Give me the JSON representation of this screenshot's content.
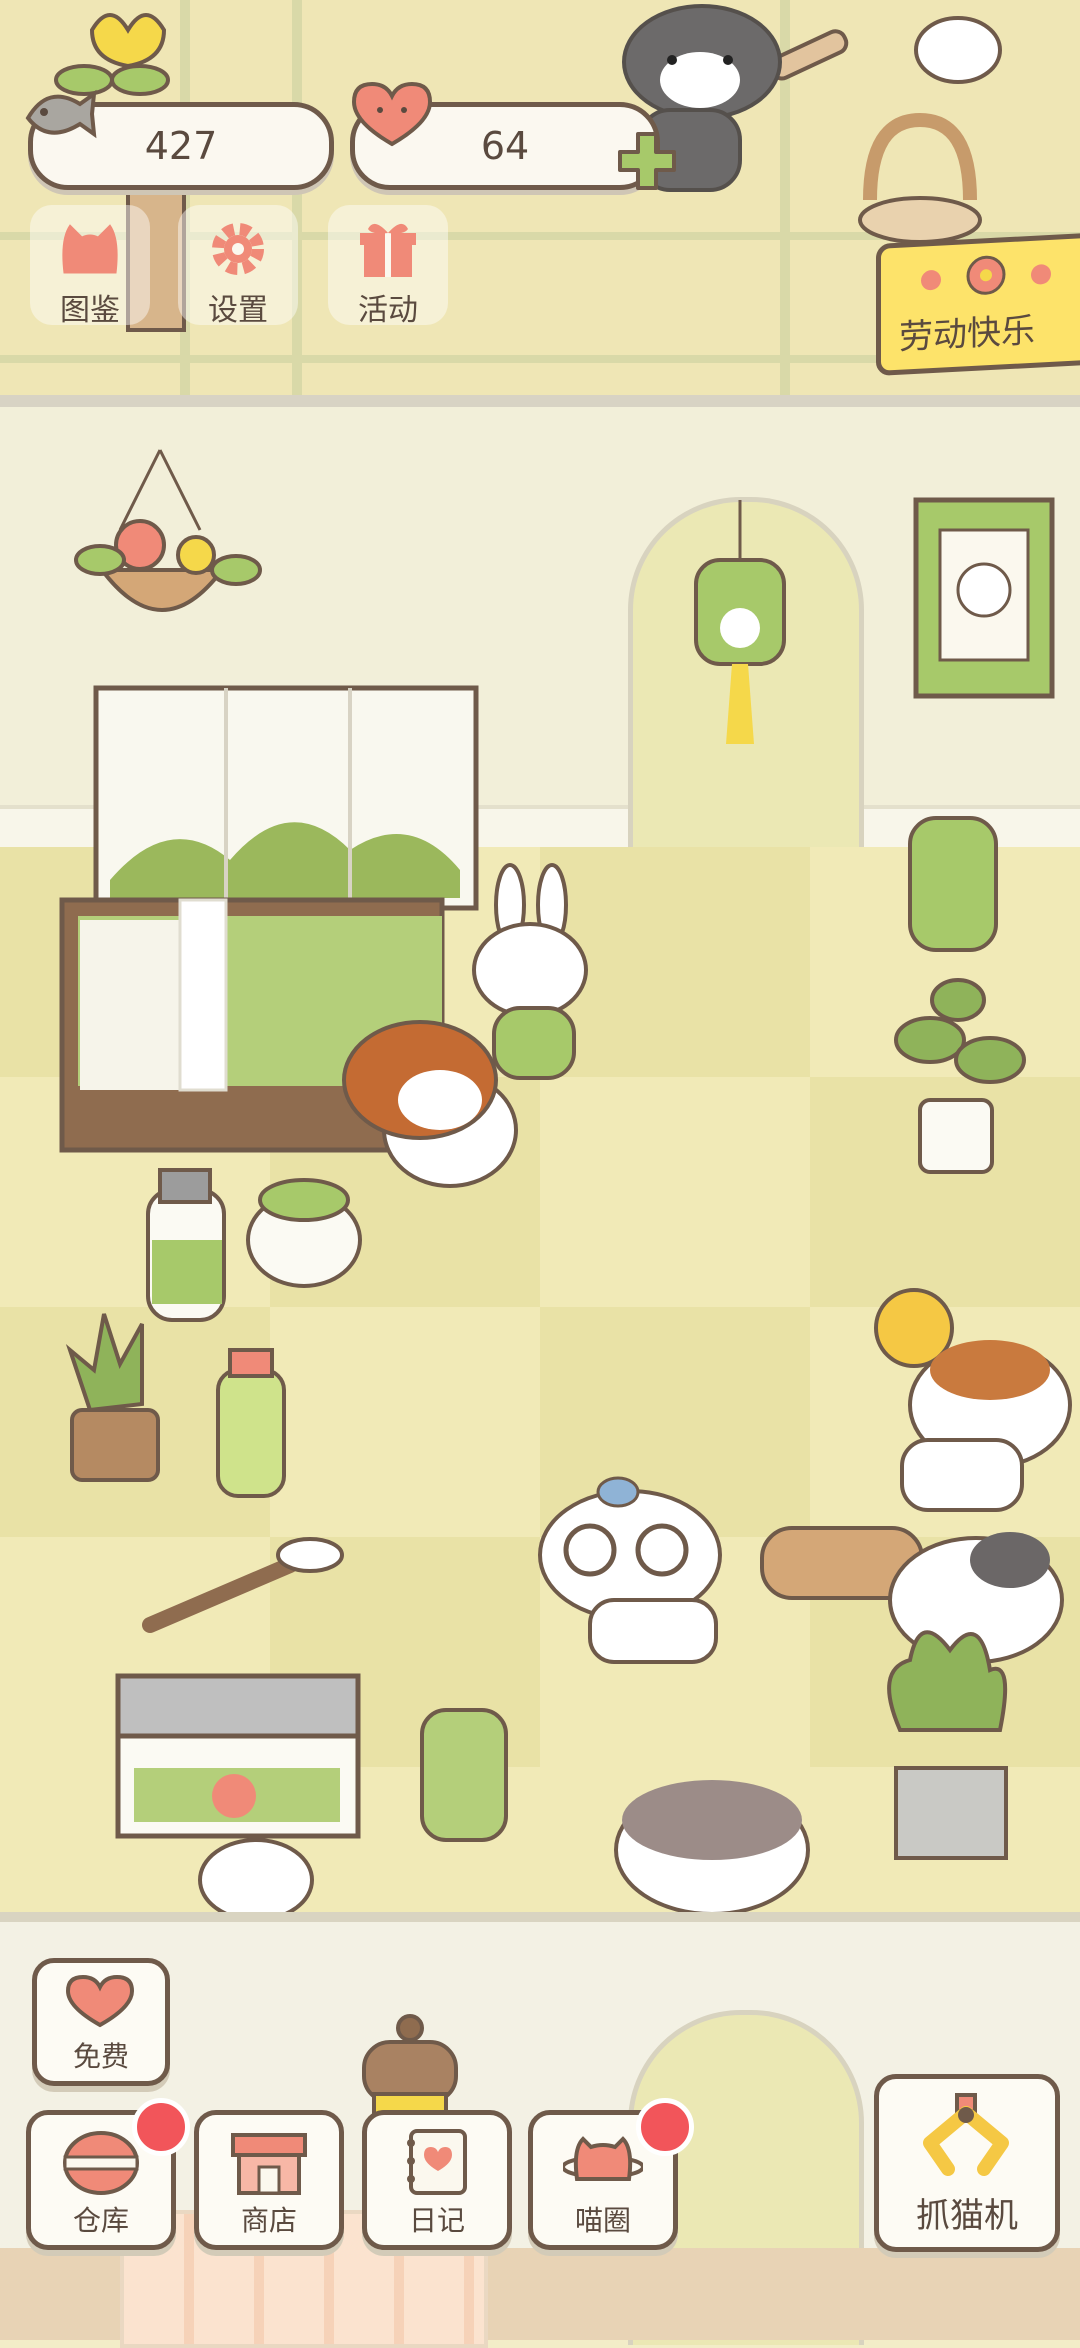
{
  "currency": {
    "fish": "427",
    "hearts": "64"
  },
  "top_menu": {
    "catalog": "图鉴",
    "settings": "设置",
    "events": "活动"
  },
  "event_banner": "劳动快乐",
  "bottom_menu": {
    "free": "免费",
    "warehouse": "仓库",
    "shop": "商店",
    "diary": "日记",
    "cat_circle": "喵圈",
    "claw_machine": "抓猫机"
  },
  "colors": {
    "outline": "#6f5a4a",
    "badge": "#f2555a",
    "accent_pink": "#f08a78",
    "accent_green": "#a7c96a",
    "banner": "#fde36a"
  }
}
